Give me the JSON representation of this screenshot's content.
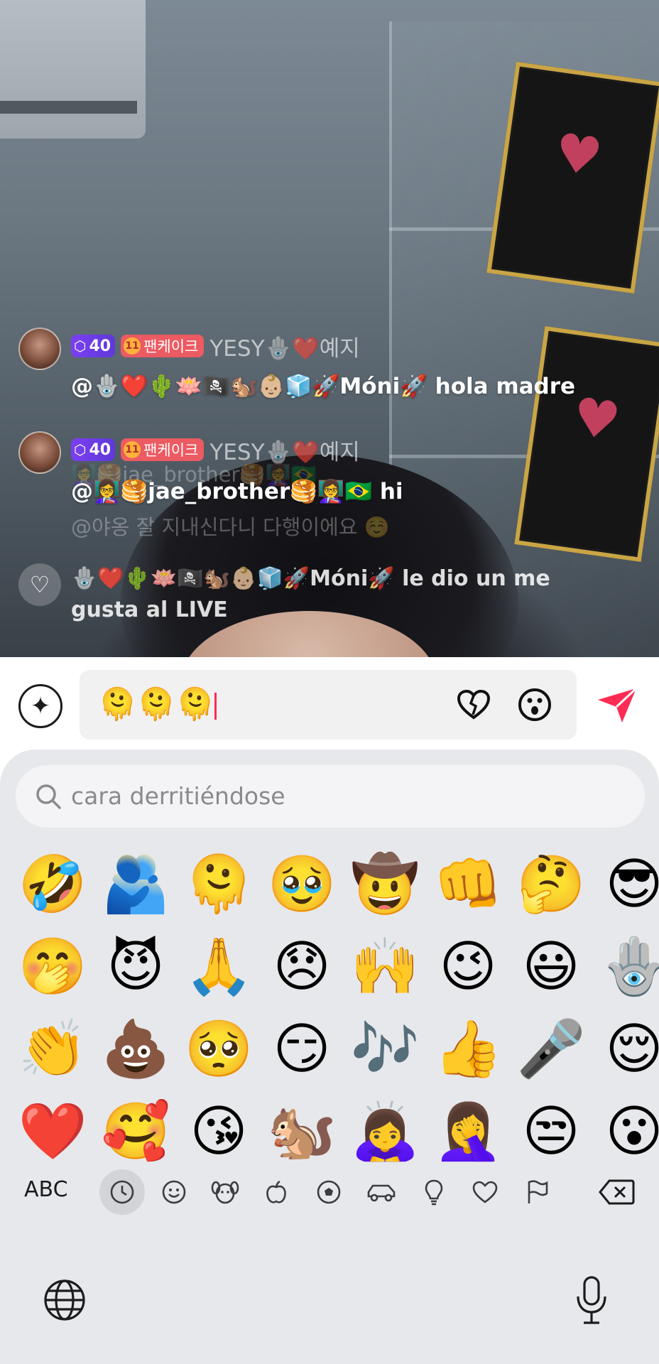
{
  "chat": {
    "messages": [
      {
        "level": "40",
        "fan_badge": "팬케이크",
        "username": "YESY🪬❤️예지",
        "text": "@🪬❤️🌵🪷🏴‍☠️🐿️👶🏼🧊🚀Móni🚀 hola madre"
      },
      {
        "level": "40",
        "fan_badge": "팬케이크",
        "username": "YESY🪬❤️예지",
        "text": "@👩‍🏫🥞jae_brother🥞👩‍🏫🇧🇷 hi",
        "ghost_above": "👩‍🏫🥞jae_brother🥞👩‍🏫🇧🇷",
        "ghost_below": "@야옹 잘 지내신다니 다행이에요 ☺️"
      }
    ],
    "like_notice": "🪬❤️🌵🪷🏴‍☠️🐿️👶🏼🧊🚀Móni🚀 le dio un me gusta al LIVE"
  },
  "input": {
    "value": "🫠🫠🫠"
  },
  "keyboard": {
    "search_text": "cara derritiéndose",
    "emojis": [
      "🤣",
      "🫂",
      "🫠",
      "🥹",
      "🤠",
      "👊",
      "🤔",
      "😎",
      "🤭",
      "😈",
      "🙏",
      "😞",
      "🙌",
      "😉",
      "😃",
      "🪬",
      "👏",
      "💩",
      "🥺",
      "😏",
      "🎶",
      "👍",
      "🎤",
      "😌",
      "❤️",
      "🥰",
      "😘",
      "🐿️",
      "🙇‍♀️",
      "🤦‍♀️",
      "😒",
      "😮"
    ],
    "abc_label": "ABC",
    "categories": [
      "recent-icon",
      "smiley-icon",
      "animal-icon",
      "food-icon",
      "ball-icon",
      "car-icon",
      "lightbulb-icon",
      "heart-icon",
      "flag-icon"
    ],
    "accent": "#fe2c55"
  }
}
